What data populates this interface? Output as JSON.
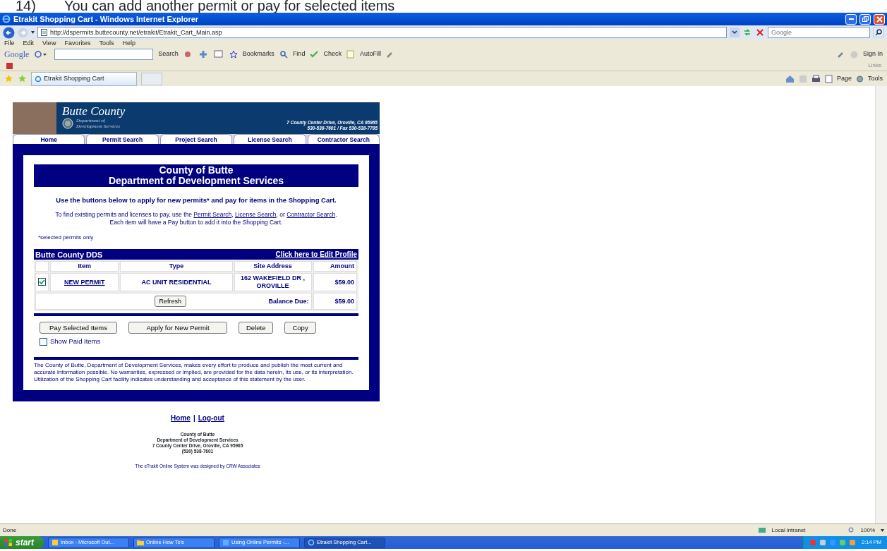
{
  "caption": {
    "number": "14)",
    "text": "You can add another permit or pay for selected items"
  },
  "window": {
    "title": "Etrakit Shopping Cart - Windows Internet Explorer"
  },
  "address_bar": {
    "url": "http://dspermits.buttecounty.net/etrakit/Etrakit_Cart_Main.asp",
    "search_placeholder": "Google"
  },
  "menu": [
    "File",
    "Edit",
    "View",
    "Favorites",
    "Tools",
    "Help"
  ],
  "google_toolbar": {
    "label": "Google",
    "search": "Search",
    "items": [
      "Bookmarks",
      "Find",
      "Check",
      "AutoFill"
    ],
    "sign_in": "Sign In",
    "links": "Links"
  },
  "tab": {
    "label": "Etrakit Shopping Cart"
  },
  "command_bar": [
    "Page",
    "Tools"
  ],
  "banner": {
    "title": "Butte County",
    "subtitle_lines": [
      "Department of",
      "Development Services"
    ],
    "address": "7 County Center Drive, Oroville, CA 95965",
    "phone": "530-538-7601 / Fax 530-538-7785"
  },
  "nav_tabs": [
    "Home",
    "Permit Search",
    "Project Search",
    "License Search",
    "Contractor Search"
  ],
  "heading": [
    "County of Butte",
    "Department of Development Services"
  ],
  "intro": "Use the buttons below to apply for new permits* and pay for items in the Shopping Cart.",
  "find_text": [
    {
      "text": "To find existing permits and licenses to pay, use the ",
      "kind": "text"
    },
    {
      "text": "Permit Search",
      "kind": "link"
    },
    {
      "text": ", ",
      "kind": "text"
    },
    {
      "text": "License Search",
      "kind": "link"
    },
    {
      "text": ", or ",
      "kind": "text"
    },
    {
      "text": "Contractor Search",
      "kind": "link"
    },
    {
      "text": ". Each item will have a Pay button to add it into the Shopping Cart.",
      "kind": "text"
    }
  ],
  "footnote": "*selected permits only",
  "cart": {
    "title": "Butte County DDS",
    "profile_link": "Click here to Edit Profile",
    "columns": [
      "Item",
      "Type",
      "Site Address",
      "Amount"
    ],
    "rows": [
      {
        "checked": true,
        "item": "NEW PERMIT",
        "type": "AC UNIT RESIDENTIAL",
        "address": "162 WAKEFIELD DR , OROVILLE",
        "amount": "$59.00"
      }
    ],
    "refresh": "Refresh",
    "balance_label": "Balance Due:",
    "balance": "$59.00"
  },
  "actions": [
    "Pay Selected Items",
    "Apply for New Permit",
    "Delete",
    "Copy"
  ],
  "show_paid": {
    "label": "Show Paid Items",
    "checked": false
  },
  "disclaimer": "The County of Butte, Department of Development Services, makes every effort to produce and publish the most current and accurate information possible. No warranties, expressed or implied, are provided for the data herein, its use, or its interpretation. Utilization of the Shopping Cart facility indicates understanding and acceptance of this statement by the user.",
  "footer_links": [
    "Home",
    "Log-out"
  ],
  "footer_separator": "|",
  "footer_address": [
    "County of Butte",
    "Department of Development Services",
    "7 County Center Drive, Oroville, CA 95965",
    "(530) 538-7601"
  ],
  "credit": "The eTrakit Online System was designed by CRW Associates",
  "status_bar": {
    "text": "Done",
    "zone": "Local intranet",
    "zoom": "100%"
  },
  "taskbar": {
    "start": "start",
    "items": [
      {
        "label": "Inbox - Microsoft Out...",
        "selected": false
      },
      {
        "label": "Online How To's",
        "selected": false
      },
      {
        "label": "Using Online Permits -...",
        "selected": false
      },
      {
        "label": "Etrakit Shopping Cart...",
        "selected": true
      }
    ],
    "clock": "2:14 PM"
  }
}
